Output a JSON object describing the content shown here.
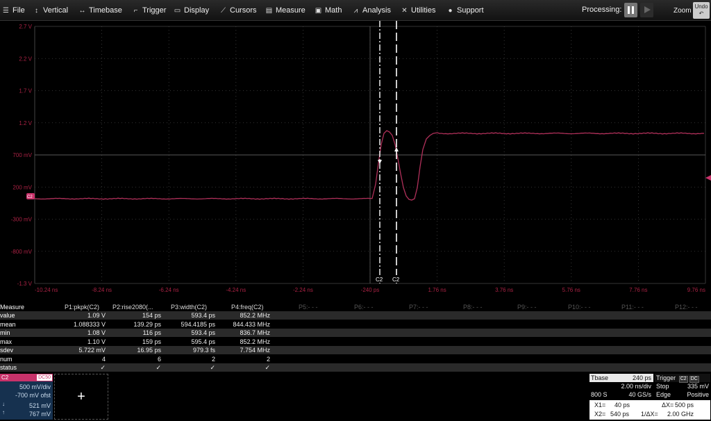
{
  "menu": {
    "items": [
      {
        "label": "File",
        "icon": "file-icon",
        "glyph": "☰"
      },
      {
        "label": "Vertical",
        "icon": "vertical-icon",
        "glyph": "↕"
      },
      {
        "label": "Timebase",
        "icon": "timebase-icon",
        "glyph": "↔"
      },
      {
        "label": "Trigger",
        "icon": "trigger-icon",
        "glyph": "⌐"
      },
      {
        "label": "Display",
        "icon": "display-icon",
        "glyph": "▭"
      },
      {
        "label": "Cursors",
        "icon": "cursors-icon",
        "glyph": "⟋"
      },
      {
        "label": "Measure",
        "icon": "measure-icon",
        "glyph": "▤"
      },
      {
        "label": "Math",
        "icon": "math-icon",
        "glyph": "▣"
      },
      {
        "label": "Analysis",
        "icon": "analysis-icon",
        "glyph": "⩘"
      },
      {
        "label": "Utilities",
        "icon": "utilities-icon",
        "glyph": "✕"
      },
      {
        "label": "Support",
        "icon": "support-icon",
        "glyph": "●"
      }
    ],
    "processing_label": "Processing:",
    "zoom_label": "Zoom",
    "undo_label": "Undo"
  },
  "grid": {
    "y_labels": [
      "2.7 V",
      "2.2 V",
      "1.7 V",
      "1.2 V",
      "700 mV",
      "200 mV",
      "-300 mV",
      "-800 mV",
      "-1.3 V"
    ],
    "x_labels": [
      "-10.24 ns",
      "-8.24 ns",
      "-6.24 ns",
      "-4.24 ns",
      "-2.24 ns",
      "-240 ps",
      "1.76 ns",
      "3.76 ns",
      "5.76 ns",
      "7.76 ns",
      "9.76 ns"
    ],
    "cursor_labels": [
      "C2",
      "C2"
    ],
    "trace_marker": "C2",
    "trace_color": "#b0305a"
  },
  "measure": {
    "title": "Measure",
    "params": [
      "P1:pkpk(C2)",
      "P2:rise2080(...",
      "P3:width(C2)",
      "P4:freq(C2)"
    ],
    "empty_params": [
      "P5:- - -",
      "P6:- - -",
      "P7:- - -",
      "P8:- - -",
      "P9:- - -",
      "P10:- - -",
      "P11:- - -",
      "P12:- - -"
    ],
    "rows": [
      {
        "label": "value",
        "cells": [
          "1.09 V",
          "154 ps",
          "593.4 ps",
          "852.2 MHz"
        ]
      },
      {
        "label": "mean",
        "cells": [
          "1.088333 V",
          "139.29 ps",
          "594.4185 ps",
          "844.433 MHz"
        ]
      },
      {
        "label": "min",
        "cells": [
          "1.08 V",
          "116 ps",
          "593.4 ps",
          "836.7 MHz"
        ]
      },
      {
        "label": "max",
        "cells": [
          "1.10 V",
          "159 ps",
          "595.4 ps",
          "852.2 MHz"
        ]
      },
      {
        "label": "sdev",
        "cells": [
          "5.722 mV",
          "16.95 ps",
          "979.3 fs",
          "7.754 MHz"
        ]
      },
      {
        "label": "num",
        "cells": [
          "4",
          "6",
          "2",
          "2"
        ]
      },
      {
        "label": "status",
        "cells": [
          "✓",
          "✓",
          "✓",
          "✓"
        ]
      }
    ]
  },
  "channel": {
    "name": "C2",
    "coupling": "DC50",
    "vdiv": "500 mV/div",
    "offset": "-700 mV ofst",
    "cursor1": "521 mV",
    "cursor2": "767 mV",
    "add_label": "+"
  },
  "timebase": {
    "title": "Tbase",
    "delay": "240 ps",
    "tdiv": "2.00 ns/div",
    "samples": "800 S",
    "rate": "40 GS/s"
  },
  "trigger": {
    "title": "Trigger",
    "badge1": "C2",
    "badge2": "DC",
    "mode": "Stop",
    "level": "335 mV",
    "type": "Edge",
    "slope": "Positive"
  },
  "cursors": {
    "x1_label": "X1=",
    "x1": "40 ps",
    "dx_label": "ΔX=",
    "dx": "500 ps",
    "x2_label": "X2=",
    "x2": "540 ps",
    "inv_label": "1/ΔX=",
    "inv": "2.00 GHz"
  }
}
